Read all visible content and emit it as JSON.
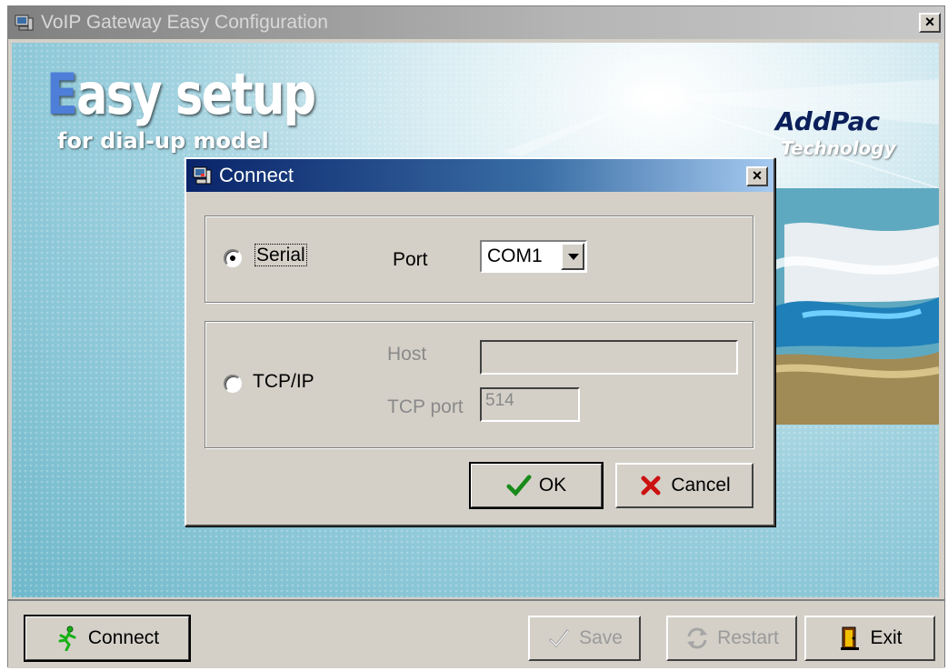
{
  "window": {
    "title": "VoIP Gateway Easy Configuration",
    "close_label": "×",
    "icon": "app-computer-icon"
  },
  "banner": {
    "headline_first": "E",
    "headline_rest": "asy setup",
    "subtitle": "for dial-up model",
    "brand_name": "AddPac",
    "brand_sub": "Technology"
  },
  "dialog": {
    "title": "Connect",
    "close_label": "×",
    "icon": "connect-computer-icon",
    "serial": {
      "label": "Serial",
      "selected": true,
      "port_label": "Port",
      "port_value": "COM1"
    },
    "tcpip": {
      "label": "TCP/IP",
      "selected": false,
      "host_label": "Host",
      "host_value": "",
      "tcp_port_label": "TCP port",
      "tcp_port_value": "514"
    },
    "ok_label": "OK",
    "cancel_label": "Cancel",
    "ok_icon": "checkmark-icon",
    "cancel_icon": "x-icon"
  },
  "toolbar": {
    "connect_label": "Connect",
    "save_label": "Save",
    "restart_label": "Restart",
    "exit_label": "Exit",
    "save_enabled": false,
    "restart_enabled": false
  },
  "colors": {
    "window_face": "#d4d0c8",
    "dialog_title": "#0a246a",
    "ok_check": "#1a8a1a",
    "cancel_x": "#cc1111",
    "connect_icon": "#17b117"
  }
}
